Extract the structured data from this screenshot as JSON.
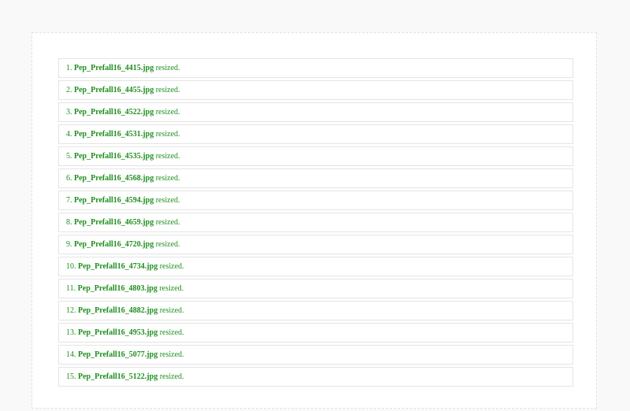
{
  "colors": {
    "page_background": "#f9f9f9",
    "panel_background": "#ffffff",
    "success_text": "#1f8f1f",
    "item_border": "#e4e4e4"
  },
  "log": {
    "suffix": "resized.",
    "items": [
      {
        "index": "1.",
        "file": "Pep_Prefall16_4415.jpg"
      },
      {
        "index": "2.",
        "file": "Pep_Prefall16_4455.jpg"
      },
      {
        "index": "3.",
        "file": "Pep_Prefall16_4522.jpg"
      },
      {
        "index": "4.",
        "file": "Pep_Prefall16_4531.jpg"
      },
      {
        "index": "5.",
        "file": "Pep_Prefall16_4535.jpg"
      },
      {
        "index": "6.",
        "file": "Pep_Prefall16_4568.jpg"
      },
      {
        "index": "7.",
        "file": "Pep_Prefall16_4594.jpg"
      },
      {
        "index": "8.",
        "file": "Pep_Prefall16_4659.jpg"
      },
      {
        "index": "9.",
        "file": "Pep_Prefall16_4720.jpg"
      },
      {
        "index": "10.",
        "file": "Pep_Prefall16_4734.jpg"
      },
      {
        "index": "11.",
        "file": "Pep_Prefall16_4803.jpg"
      },
      {
        "index": "12.",
        "file": "Pep_Prefall16_4882.jpg"
      },
      {
        "index": "13.",
        "file": "Pep_Prefall16_4953.jpg"
      },
      {
        "index": "14.",
        "file": "Pep_Prefall16_5077.jpg"
      },
      {
        "index": "15.",
        "file": "Pep_Prefall16_5122.jpg"
      }
    ]
  }
}
